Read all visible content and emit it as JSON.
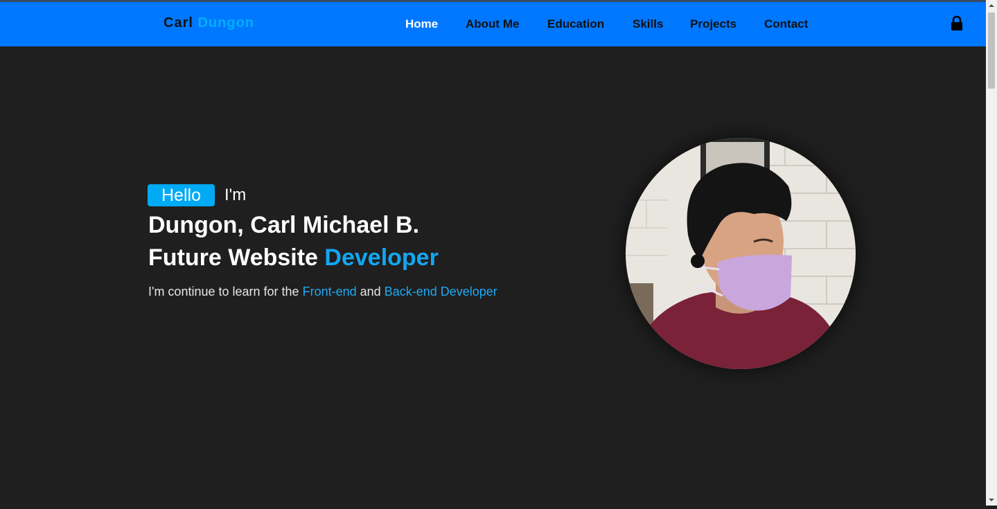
{
  "brand": {
    "first": "Carl",
    "last": "Dungon"
  },
  "nav": {
    "items": [
      {
        "label": "Home",
        "active": true
      },
      {
        "label": "About Me",
        "active": false
      },
      {
        "label": "Education",
        "active": false
      },
      {
        "label": "Skills",
        "active": false
      },
      {
        "label": "Projects",
        "active": false
      },
      {
        "label": "Contact",
        "active": false
      }
    ],
    "lock_icon": "lock-icon"
  },
  "hero": {
    "hello": "Hello",
    "im": "I'm",
    "name": "Dungon, Carl Michael B.",
    "role_prefix": "Future Website",
    "role_accent": "Developer",
    "desc_1": "I'm continue to learn for the",
    "desc_front": "Front-end",
    "desc_and": "and",
    "desc_back": "Back-end Developer"
  },
  "colors": {
    "navbar": "#0077ff",
    "accent": "#00aaf5",
    "background": "#1f1f1f"
  }
}
